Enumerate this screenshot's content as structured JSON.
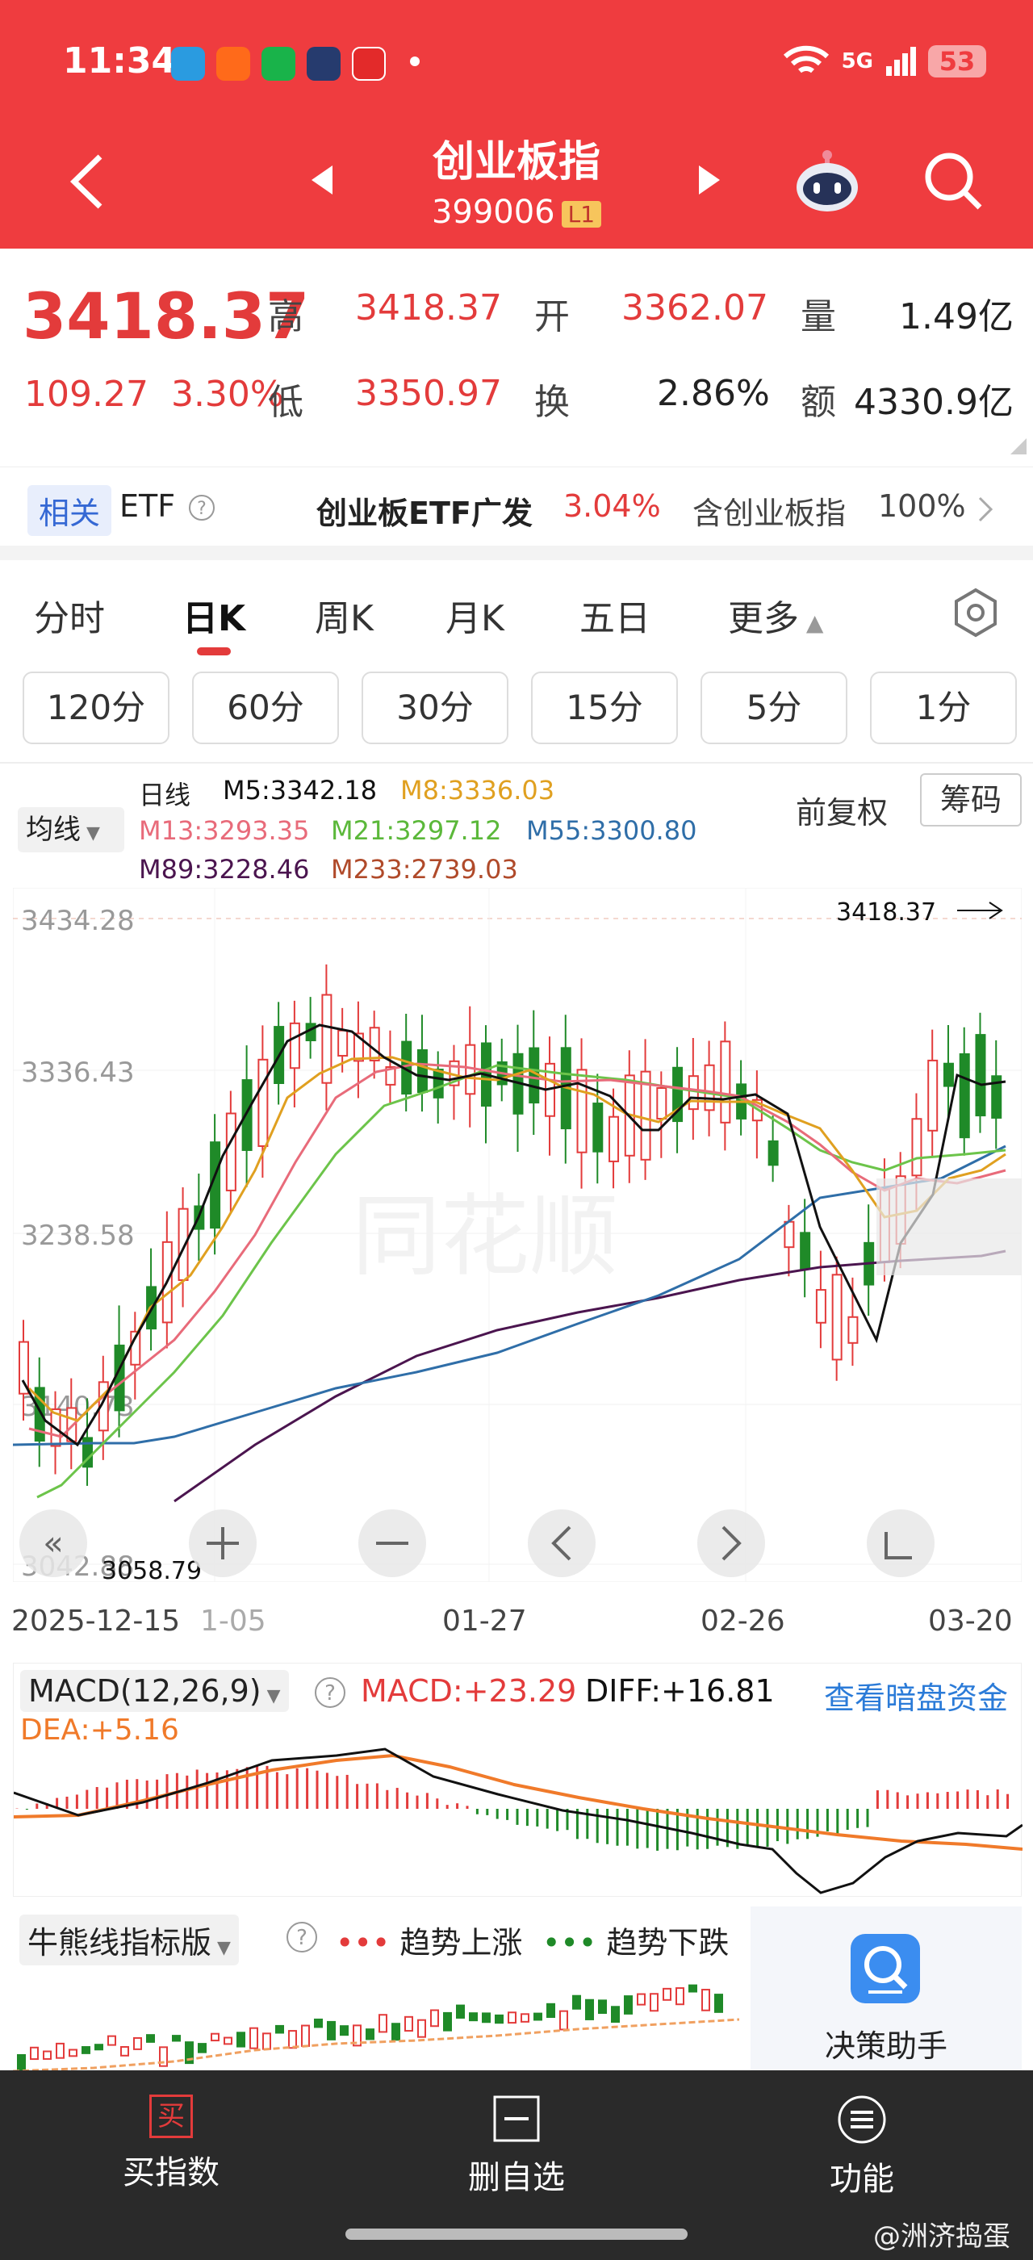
{
  "status": {
    "time": "11:34",
    "network": "5G",
    "battery": "53"
  },
  "header": {
    "title": "创业板指",
    "code": "399006",
    "level_badge": "L1"
  },
  "quote": {
    "price": "3418.37",
    "change": "109.27",
    "change_pct": "3.30%",
    "high_label": "高",
    "high": "3418.37",
    "open_label": "开",
    "open": "3362.07",
    "volume_label": "量",
    "volume": "1.49亿",
    "low_label": "低",
    "low": "3350.97",
    "turnover_label": "换",
    "turnover": "2.86%",
    "amount_label": "额",
    "amount": "4330.9亿"
  },
  "etf": {
    "tag": "相关",
    "label": "ETF",
    "name": "创业板ETF广发",
    "pct": "3.04%",
    "contains": "含创业板指",
    "contains_pct": "100%"
  },
  "tabs": [
    "分时",
    "日K",
    "周K",
    "月K",
    "五日",
    "更多"
  ],
  "sub_tabs": [
    "120分",
    "60分",
    "30分",
    "15分",
    "5分",
    "1分"
  ],
  "ma_legend": {
    "selector": "均线",
    "period": "日线",
    "m5": "M5:3342.18",
    "m8": "M8:3336.03",
    "m13": "M13:3293.35",
    "m21": "M21:3297.12",
    "m55": "M55:3300.80",
    "m89": "M89:3228.46",
    "m233": "M233:2739.03",
    "adjust": "前复权",
    "chip_button": "筹码"
  },
  "colors": {
    "up": "#e33b3b",
    "down": "#1f8a28",
    "m5": "#111111",
    "m8": "#e0a020",
    "m13": "#e86b7a",
    "m21": "#6cc44a",
    "m55": "#2f6ea8",
    "m89": "#4b154f",
    "m233": "#b04a2a"
  },
  "kline": {
    "y_ticks": [
      "3434.28",
      "3336.43",
      "3238.58",
      "3140.73",
      "3042.88"
    ],
    "high_marker": "3418.37",
    "low_marker": "3058.79",
    "x_labels": [
      "2025-12-15",
      "1-05",
      "01-27",
      "02-26",
      "03-20"
    ],
    "watermark": "同花顺"
  },
  "macd": {
    "title": "MACD(12,26,9)",
    "macd": "MACD:+23.29",
    "diff": "DIFF:+16.81",
    "dea": "DEA:+5.16",
    "link": "查看暗盘资金"
  },
  "bull": {
    "title": "牛熊线指标版",
    "up_label": "趋势上涨",
    "down_label": "趋势下跌",
    "assistant": "决策助手"
  },
  "nav": {
    "buy_icon_text": "买",
    "buy": "买指数",
    "delete": "删自选",
    "func": "功能"
  },
  "watermark_user": "@洲济捣蛋"
}
